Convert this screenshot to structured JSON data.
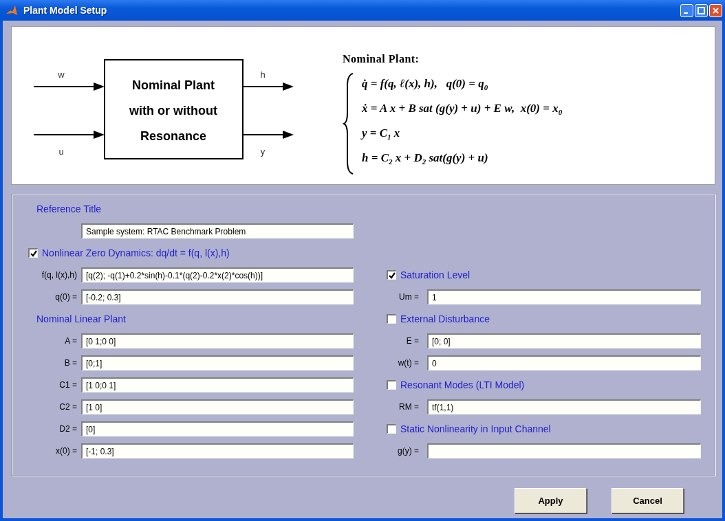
{
  "window": {
    "title": "Plant Model Setup"
  },
  "diagram": {
    "block_lines": [
      "Nominal Plant",
      "with or without",
      "Resonance"
    ],
    "inputs": [
      "w",
      "u"
    ],
    "outputs": [
      "h",
      "y"
    ]
  },
  "equations": {
    "title": "Nominal Plant:",
    "lines": [
      "q̇ = f(q, ℓ(x), h),   q(0) = q$_{0}$",
      "ẋ = A x + B sat (g(y) + u) + E w,  x(0) = x$_{0}$",
      "y = C$_{1}$ x",
      "h = C$_{2}$ x + D$_{2}$ sat(g(y) + u)"
    ]
  },
  "left": [
    {
      "kind": "heading",
      "text": "Reference Title"
    },
    {
      "kind": "field",
      "value": "Sample system: RTAC Benchmark Problem"
    },
    {
      "kind": "checkbox",
      "label": "Nonlinear Zero Dynamics: dq/dt = f(q, l(x),h)",
      "checked": true
    },
    {
      "kind": "field",
      "label": "f(q, l(x),h)",
      "value": "[q(2); -q(1)+0.2*sin(h)-0.1*(q(2)-0.2*x(2)*cos(h))]"
    },
    {
      "kind": "field",
      "label": "q(0) =",
      "value": "[-0.2; 0.3]"
    },
    {
      "kind": "heading",
      "text": "Nominal Linear Plant"
    },
    {
      "kind": "field",
      "label": "A =",
      "value": "[0 1;0 0]"
    },
    {
      "kind": "field",
      "label": "B =",
      "value": "[0;1]"
    },
    {
      "kind": "field",
      "label": "C1 =",
      "value": "[1 0;0 1]"
    },
    {
      "kind": "field",
      "label": "C2 =",
      "value": "[1 0]"
    },
    {
      "kind": "field",
      "label": "D2 =",
      "value": "[0]"
    },
    {
      "kind": "field",
      "label": "x(0) =",
      "value": "[-1; 0.3]"
    }
  ],
  "right": [
    {
      "kind": "checkbox",
      "label": "Saturation Level",
      "checked": true
    },
    {
      "kind": "field",
      "label": "Um =",
      "value": "1"
    },
    {
      "kind": "checkbox",
      "label": "External Disturbance",
      "checked": false
    },
    {
      "kind": "field",
      "label": "E =",
      "value": "[0; 0]"
    },
    {
      "kind": "field",
      "label": "w(t) =",
      "value": "0"
    },
    {
      "kind": "checkbox",
      "label": "Resonant Modes (LTI Model)",
      "checked": false
    },
    {
      "kind": "field",
      "label": "RM =",
      "value": "tf(1,1)"
    },
    {
      "kind": "checkbox",
      "label": "Static Nonlinearity in Input Channel",
      "checked": false
    },
    {
      "kind": "field",
      "label": "g(y) ="
    }
  ],
  "buttons": [
    "Apply",
    "Cancel"
  ]
}
